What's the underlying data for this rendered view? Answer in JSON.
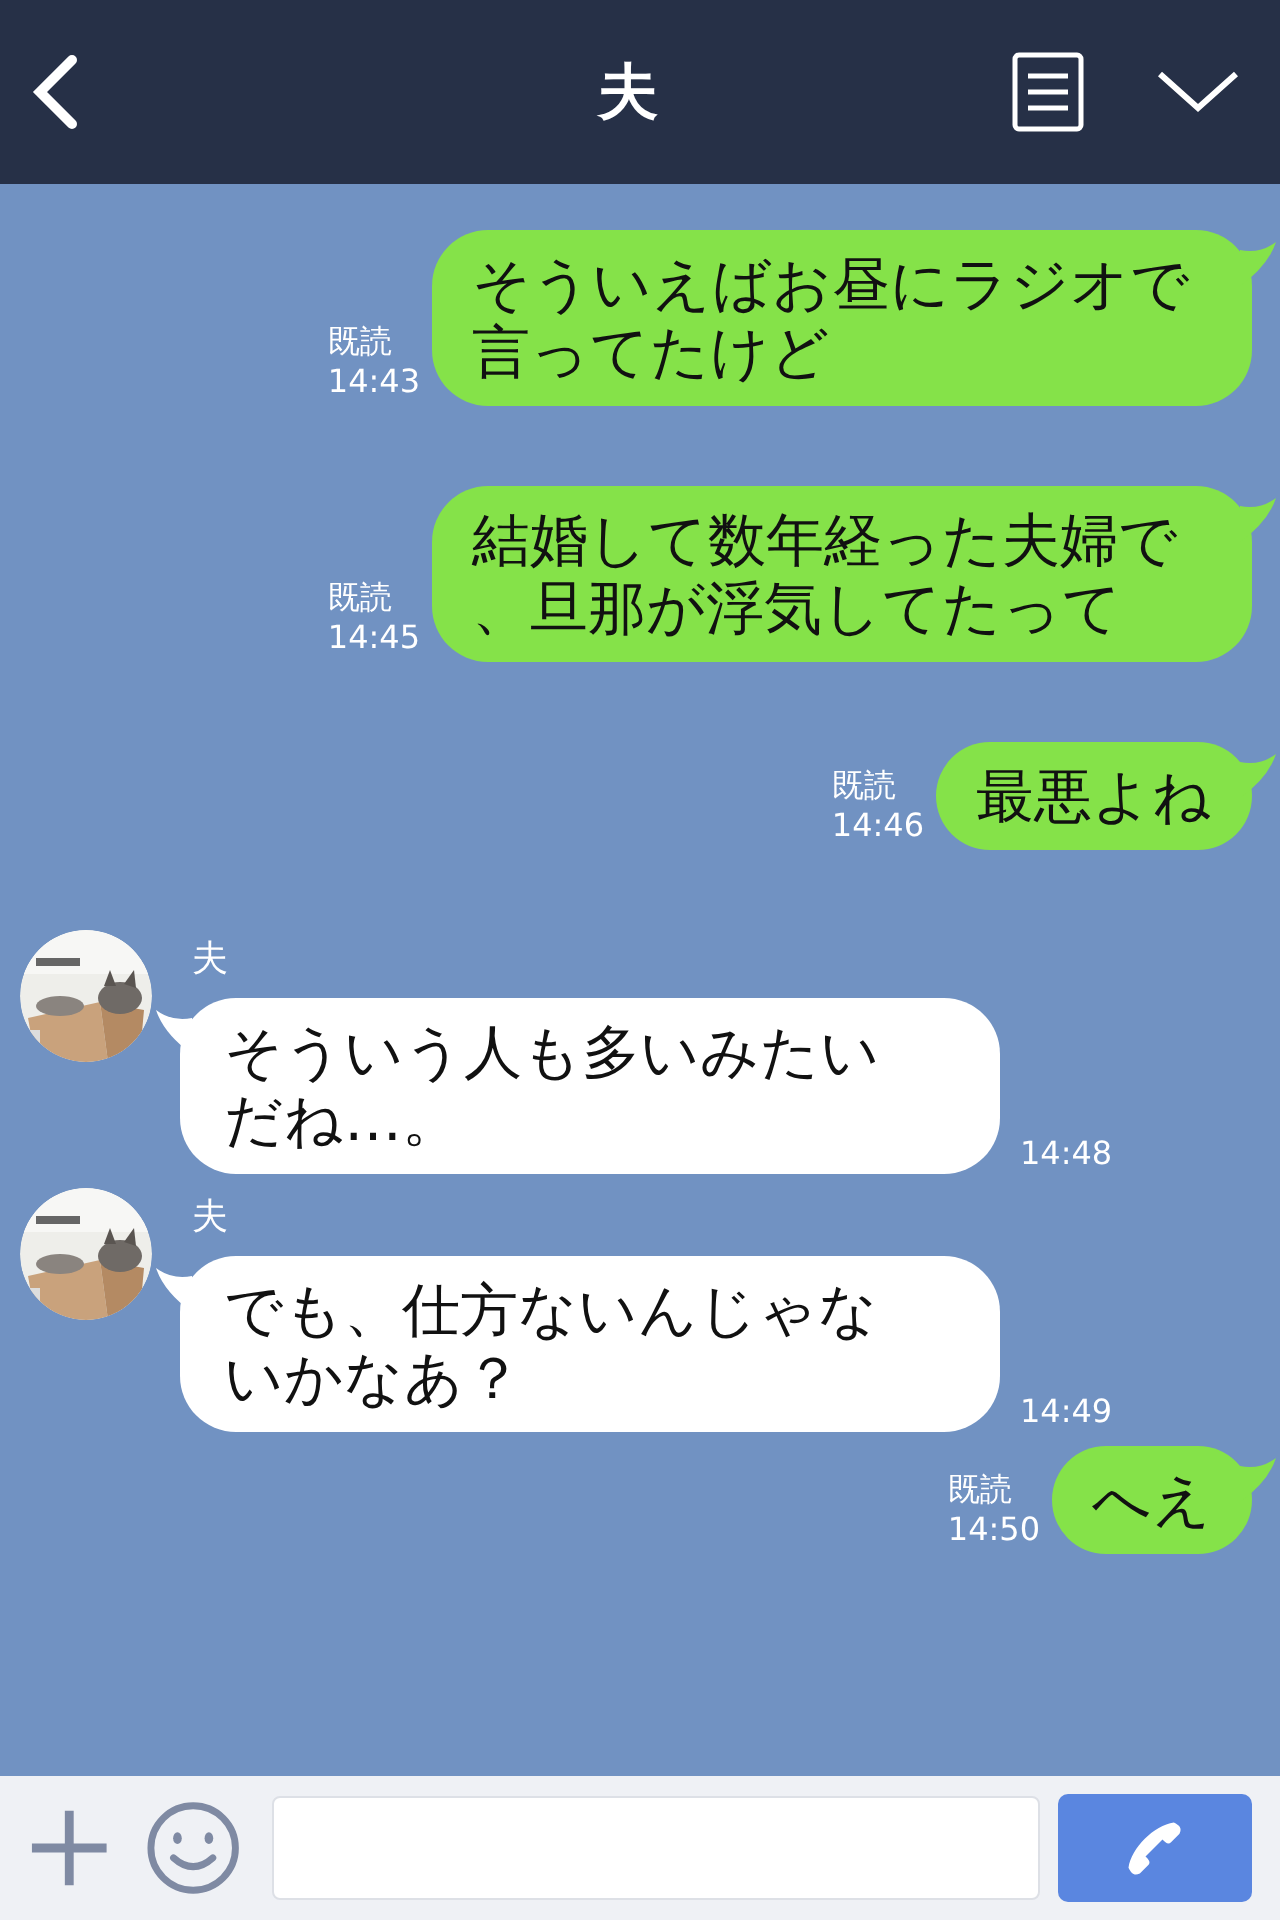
{
  "header": {
    "title": "夫"
  },
  "messages": [
    {
      "kind": "sent",
      "text": "そういえばお昼にラジオで言ってたけど",
      "read": "既読",
      "time": "14:43"
    },
    {
      "kind": "sent",
      "text": "結婚して数年経った夫婦で、旦那が浮気してたって",
      "read": "既読",
      "time": "14:45"
    },
    {
      "kind": "sent",
      "text": "最悪よね",
      "read": "既読",
      "time": "14:46"
    },
    {
      "kind": "received",
      "name": "夫",
      "text": "そういう人も多いみたいだね…。",
      "time": "14:48"
    },
    {
      "kind": "received",
      "name": "夫",
      "text": "でも、仕方ないんじゃないかなあ？",
      "time": "14:49"
    },
    {
      "kind": "sent",
      "text": "へえ",
      "read": "既読",
      "time": "14:50"
    }
  ]
}
